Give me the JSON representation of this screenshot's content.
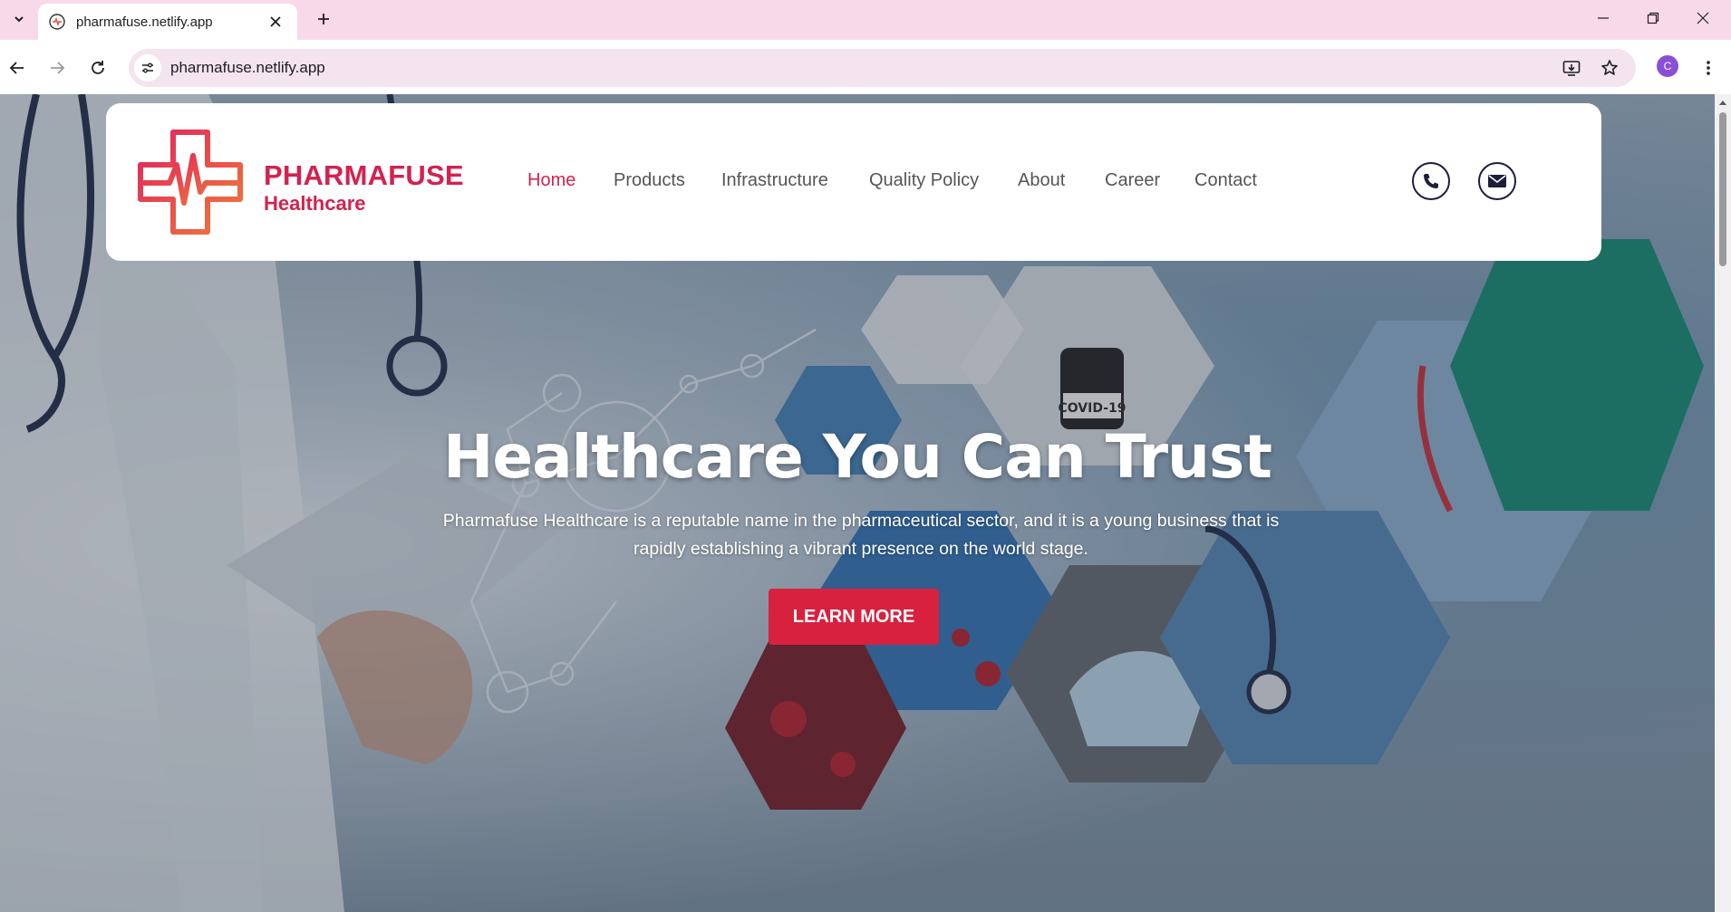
{
  "browser": {
    "tab_title": "pharmafuse.netlify.app",
    "url": "pharmafuse.netlify.app",
    "profile_initial": "C"
  },
  "site": {
    "brand_name": "PHARMAFUSE",
    "brand_sub": "Healthcare",
    "nav": [
      "Home",
      "Products",
      "Infrastructure",
      "Quality Policy",
      "About",
      "Career",
      "Contact"
    ],
    "active_nav": "Home"
  },
  "hero": {
    "title": "Healthcare You Can Trust",
    "description": "Pharmafuse Healthcare is a reputable name in the pharmaceutical sector, and it is a young business that is rapidly establishing a vibrant presence on the world stage.",
    "cta": "LEARN MORE",
    "vial_label": "COVID-19"
  },
  "colors": {
    "brand": "#d4224e",
    "cta": "#d8213f",
    "tabstrip": "#f8d9ea",
    "nav_text": "#555555"
  },
  "icons": [
    "chevron-down-icon",
    "favicon-icon",
    "close-icon",
    "plus-icon",
    "minimize-icon",
    "restore-icon",
    "window-close-icon",
    "back-icon",
    "forward-icon",
    "reload-icon",
    "site-info-icon",
    "install-app-icon",
    "star-icon",
    "kebab-icon",
    "phone-icon",
    "mail-icon",
    "logo-cross-pulse-icon"
  ]
}
